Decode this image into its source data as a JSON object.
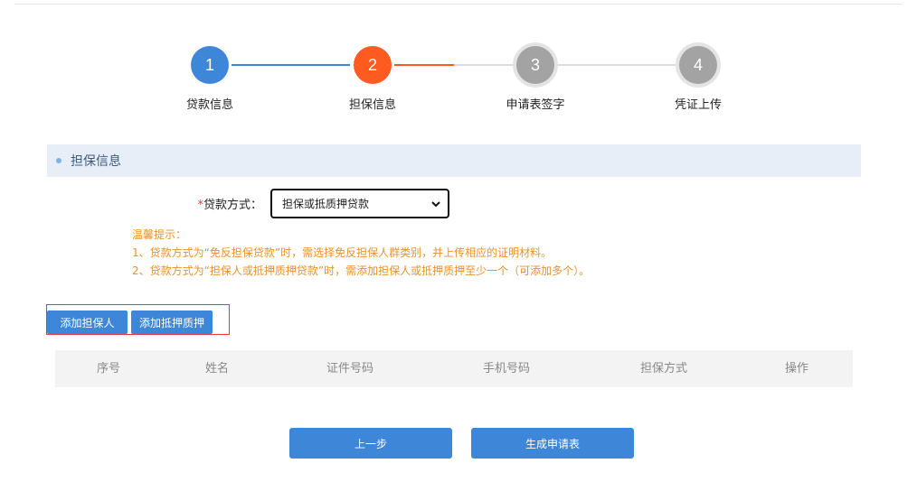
{
  "steps": [
    {
      "number": "1",
      "label": "贷款信息",
      "state": "done",
      "color": "#3d86d8"
    },
    {
      "number": "2",
      "label": "担保信息",
      "state": "active",
      "color": "#ff5a1f"
    },
    {
      "number": "3",
      "label": "申请表签字",
      "state": "pending",
      "color": "#a3a3a3"
    },
    {
      "number": "4",
      "label": "凭证上传",
      "state": "pending",
      "color": "#a3a3a3"
    }
  ],
  "colors": {
    "done": "#3d86d8",
    "active": "#ff5a1f",
    "pending": "#a3a3a3",
    "tip": "#e8922c"
  },
  "section": {
    "title": "担保信息"
  },
  "form": {
    "required_mark": "*",
    "loan_method_label": "贷款方式：",
    "loan_method_value": "担保或抵质押贷款"
  },
  "tips": {
    "heading": "温馨提示：",
    "line1": "1、贷款方式为“免反担保贷款”时，需选择免反担保人群类别，并上传相应的证明材料。",
    "line2": "2、贷款方式为“担保人或抵押质押贷款”时，需添加担保人或抵押质押至少一个（可添加多个）。"
  },
  "buttons": {
    "add_guarantor": "添加担保人",
    "add_collateral": "添加抵押质押",
    "prev_step": "上一步",
    "generate_application": "生成申请表"
  },
  "table": {
    "columns": [
      "序号",
      "姓名",
      "证件号码",
      "手机号码",
      "担保方式",
      "操作"
    ]
  }
}
